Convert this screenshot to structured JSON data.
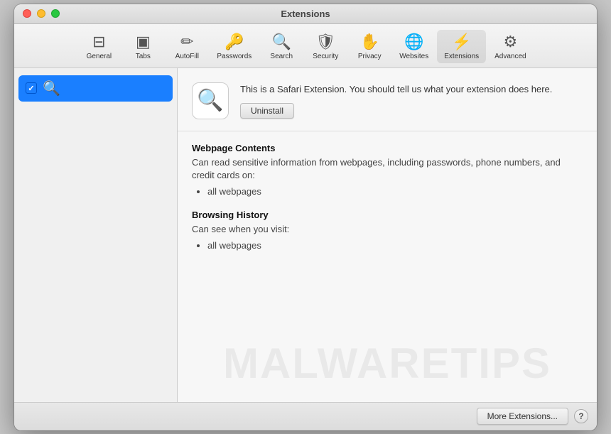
{
  "window": {
    "title": "Extensions",
    "controls": {
      "close": "close",
      "minimize": "minimize",
      "maximize": "maximize"
    }
  },
  "toolbar": {
    "items": [
      {
        "id": "general",
        "label": "General",
        "icon": "⊟"
      },
      {
        "id": "tabs",
        "label": "Tabs",
        "icon": "▣"
      },
      {
        "id": "autofill",
        "label": "AutoFill",
        "icon": "✏"
      },
      {
        "id": "passwords",
        "label": "Passwords",
        "icon": "🔑"
      },
      {
        "id": "search",
        "label": "Search",
        "icon": "🔍"
      },
      {
        "id": "security",
        "label": "Security",
        "icon": "🛡"
      },
      {
        "id": "privacy",
        "label": "Privacy",
        "icon": "✋"
      },
      {
        "id": "websites",
        "label": "Websites",
        "icon": "🌐"
      },
      {
        "id": "extensions",
        "label": "Extensions",
        "icon": "⚡",
        "active": true
      },
      {
        "id": "advanced",
        "label": "Advanced",
        "icon": "⚙"
      }
    ]
  },
  "sidebar": {
    "items": [
      {
        "id": "search-ext",
        "label": "🔍",
        "checked": true
      }
    ]
  },
  "detail": {
    "extension_icon": "🔍",
    "description": "This is a Safari Extension. You should tell us what your extension does here.",
    "uninstall_label": "Uninstall",
    "permissions": [
      {
        "title": "Webpage Contents",
        "description": "Can read sensitive information from webpages, including passwords, phone numbers, and credit cards on:",
        "items": [
          "all webpages"
        ]
      },
      {
        "title": "Browsing History",
        "description": "Can see when you visit:",
        "items": [
          "all webpages"
        ]
      }
    ]
  },
  "footer": {
    "more_extensions_label": "More Extensions...",
    "help_label": "?"
  },
  "watermark": "MALWARETIPS"
}
